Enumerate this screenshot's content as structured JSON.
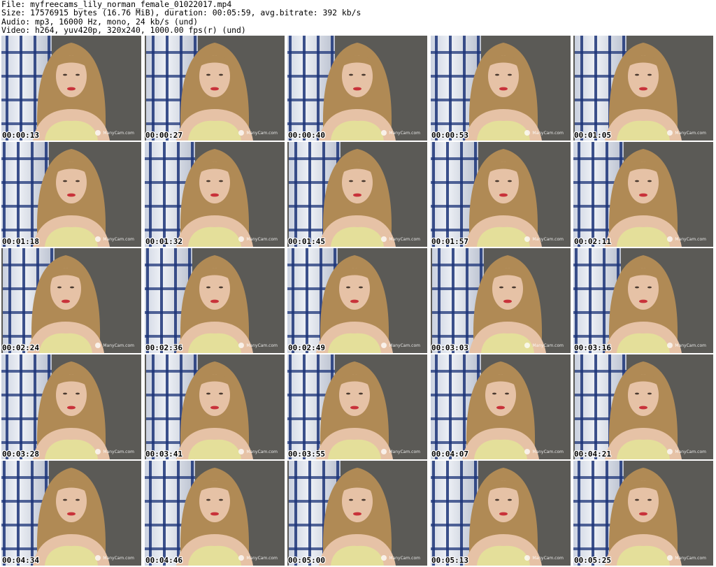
{
  "header": {
    "lines": [
      "File: myfreecams_lily_norman_female_01022017.mp4",
      "Size: 17576915 bytes (16.76 MiB), duration: 00:05:59, avg.bitrate: 392 kb/s",
      "Audio: mp3, 16000 Hz, mono, 24 kb/s (und)",
      "Video: h264, yuv420p, 320x240, 1000.00 fps(r) (und)"
    ]
  },
  "thumbnails": [
    {
      "timestamp": "00:00:13",
      "watermark": "ManyCam.com"
    },
    {
      "timestamp": "00:00:27",
      "watermark": "ManyCam.com"
    },
    {
      "timestamp": "00:00:40",
      "watermark": "ManyCam.com"
    },
    {
      "timestamp": "00:00:53",
      "watermark": "ManyCam.com"
    },
    {
      "timestamp": "00:01:05",
      "watermark": "ManyCam.com"
    },
    {
      "timestamp": "00:01:18",
      "watermark": "ManyCam.com"
    },
    {
      "timestamp": "00:01:32",
      "watermark": "ManyCam.com"
    },
    {
      "timestamp": "00:01:45",
      "watermark": "ManyCam.com"
    },
    {
      "timestamp": "00:01:57",
      "watermark": "ManyCam.com"
    },
    {
      "timestamp": "00:02:11",
      "watermark": "ManyCam.com"
    },
    {
      "timestamp": "00:02:24",
      "watermark": "ManyCam.com"
    },
    {
      "timestamp": "00:02:36",
      "watermark": "ManyCam.com"
    },
    {
      "timestamp": "00:02:49",
      "watermark": "ManyCam.com"
    },
    {
      "timestamp": "00:03:03",
      "watermark": "ManyCam.com"
    },
    {
      "timestamp": "00:03:16",
      "watermark": "ManyCam.com"
    },
    {
      "timestamp": "00:03:28",
      "watermark": "ManyCam.com"
    },
    {
      "timestamp": "00:03:41",
      "watermark": "ManyCam.com"
    },
    {
      "timestamp": "00:03:55",
      "watermark": "ManyCam.com"
    },
    {
      "timestamp": "00:04:07",
      "watermark": "ManyCam.com"
    },
    {
      "timestamp": "00:04:21",
      "watermark": "ManyCam.com"
    },
    {
      "timestamp": "00:04:34",
      "watermark": "ManyCam.com"
    },
    {
      "timestamp": "00:04:46",
      "watermark": "ManyCam.com"
    },
    {
      "timestamp": "00:05:00",
      "watermark": "ManyCam.com"
    },
    {
      "timestamp": "00:05:13",
      "watermark": "ManyCam.com"
    },
    {
      "timestamp": "00:05:25",
      "watermark": "ManyCam.com"
    }
  ],
  "colors": {
    "background": "#ffffff",
    "text": "#000000",
    "wall": "#5b5a56",
    "hair": "#b08a55",
    "skin": "#e6c2a6",
    "top": "#e4df9a",
    "lips": "#c8323a"
  }
}
